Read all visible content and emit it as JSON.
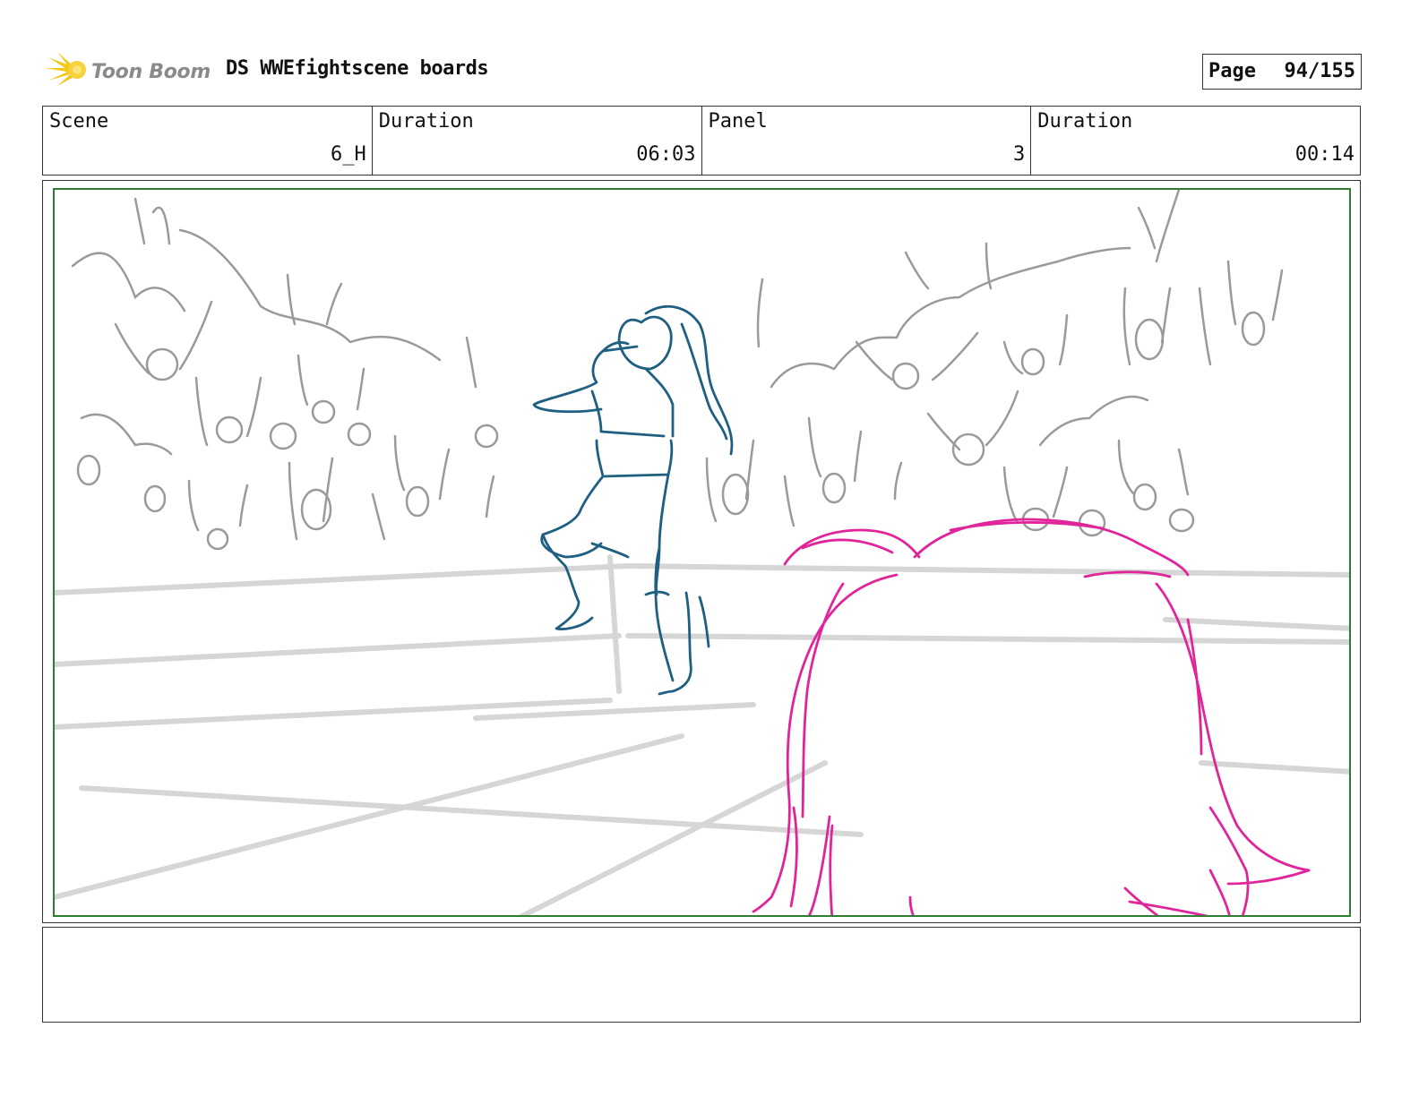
{
  "header": {
    "logo_text": "Toon Boom",
    "title": "DS WWEfightscene boards",
    "page_label": "Page",
    "page_value": "94/155"
  },
  "info": {
    "scene_label": "Scene",
    "scene_value": "6_H",
    "scene_duration_label": "Duration",
    "scene_duration_value": "06:03",
    "panel_label": "Panel",
    "panel_value": "3",
    "panel_duration_label": "Duration",
    "panel_duration_value": "00:14"
  },
  "colors": {
    "frame_border": "#2e7d32",
    "crowd_sketch": "#9a9a9a",
    "wrestler_sketch": "#1f5f82",
    "foreground_hair_sketch": "#e0259a",
    "ring_ropes": "#d6d6d6",
    "logo_accent": "#f5c518"
  },
  "drawing": {
    "elements": [
      "crowd-sketch",
      "ring-ropes",
      "wrestler-figure",
      "foreground-head"
    ]
  }
}
